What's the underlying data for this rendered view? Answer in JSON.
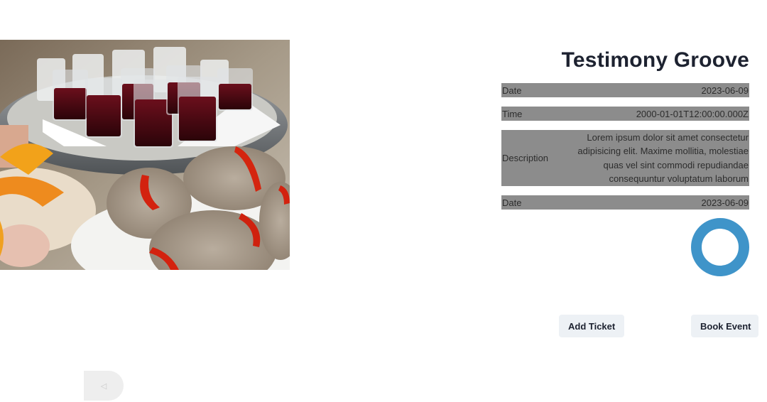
{
  "event": {
    "title": "Testimony Groove",
    "image_alt": "Glasses of red wine on a tray with bread slices topped with red pepper"
  },
  "details": {
    "date_label": "Date",
    "date_value": "2023-06-09",
    "time_label": "Time",
    "time_value": "2000-01-01T12:00:00.000Z",
    "description_label": "Description",
    "description_value": "Lorem ipsum dolor sit amet consectetur adipisicing elit. Maxime mollitia, molestiae quas vel sint commodi repudiandae consequuntur voluptatum laborum",
    "date2_label": "Date",
    "date2_value": "2023-06-09"
  },
  "actions": {
    "add_ticket_label": "Add Ticket",
    "book_event_label": "Book Event"
  },
  "nav": {
    "back_icon": "◁"
  },
  "colors": {
    "info_row_bg": "#8c8c8c",
    "spinner": "#3f94c9",
    "button_bg": "#edf1f5",
    "title": "#1d2230"
  },
  "icons": {
    "back": "back-arrow-icon",
    "loading": "loading-spinner-icon"
  }
}
